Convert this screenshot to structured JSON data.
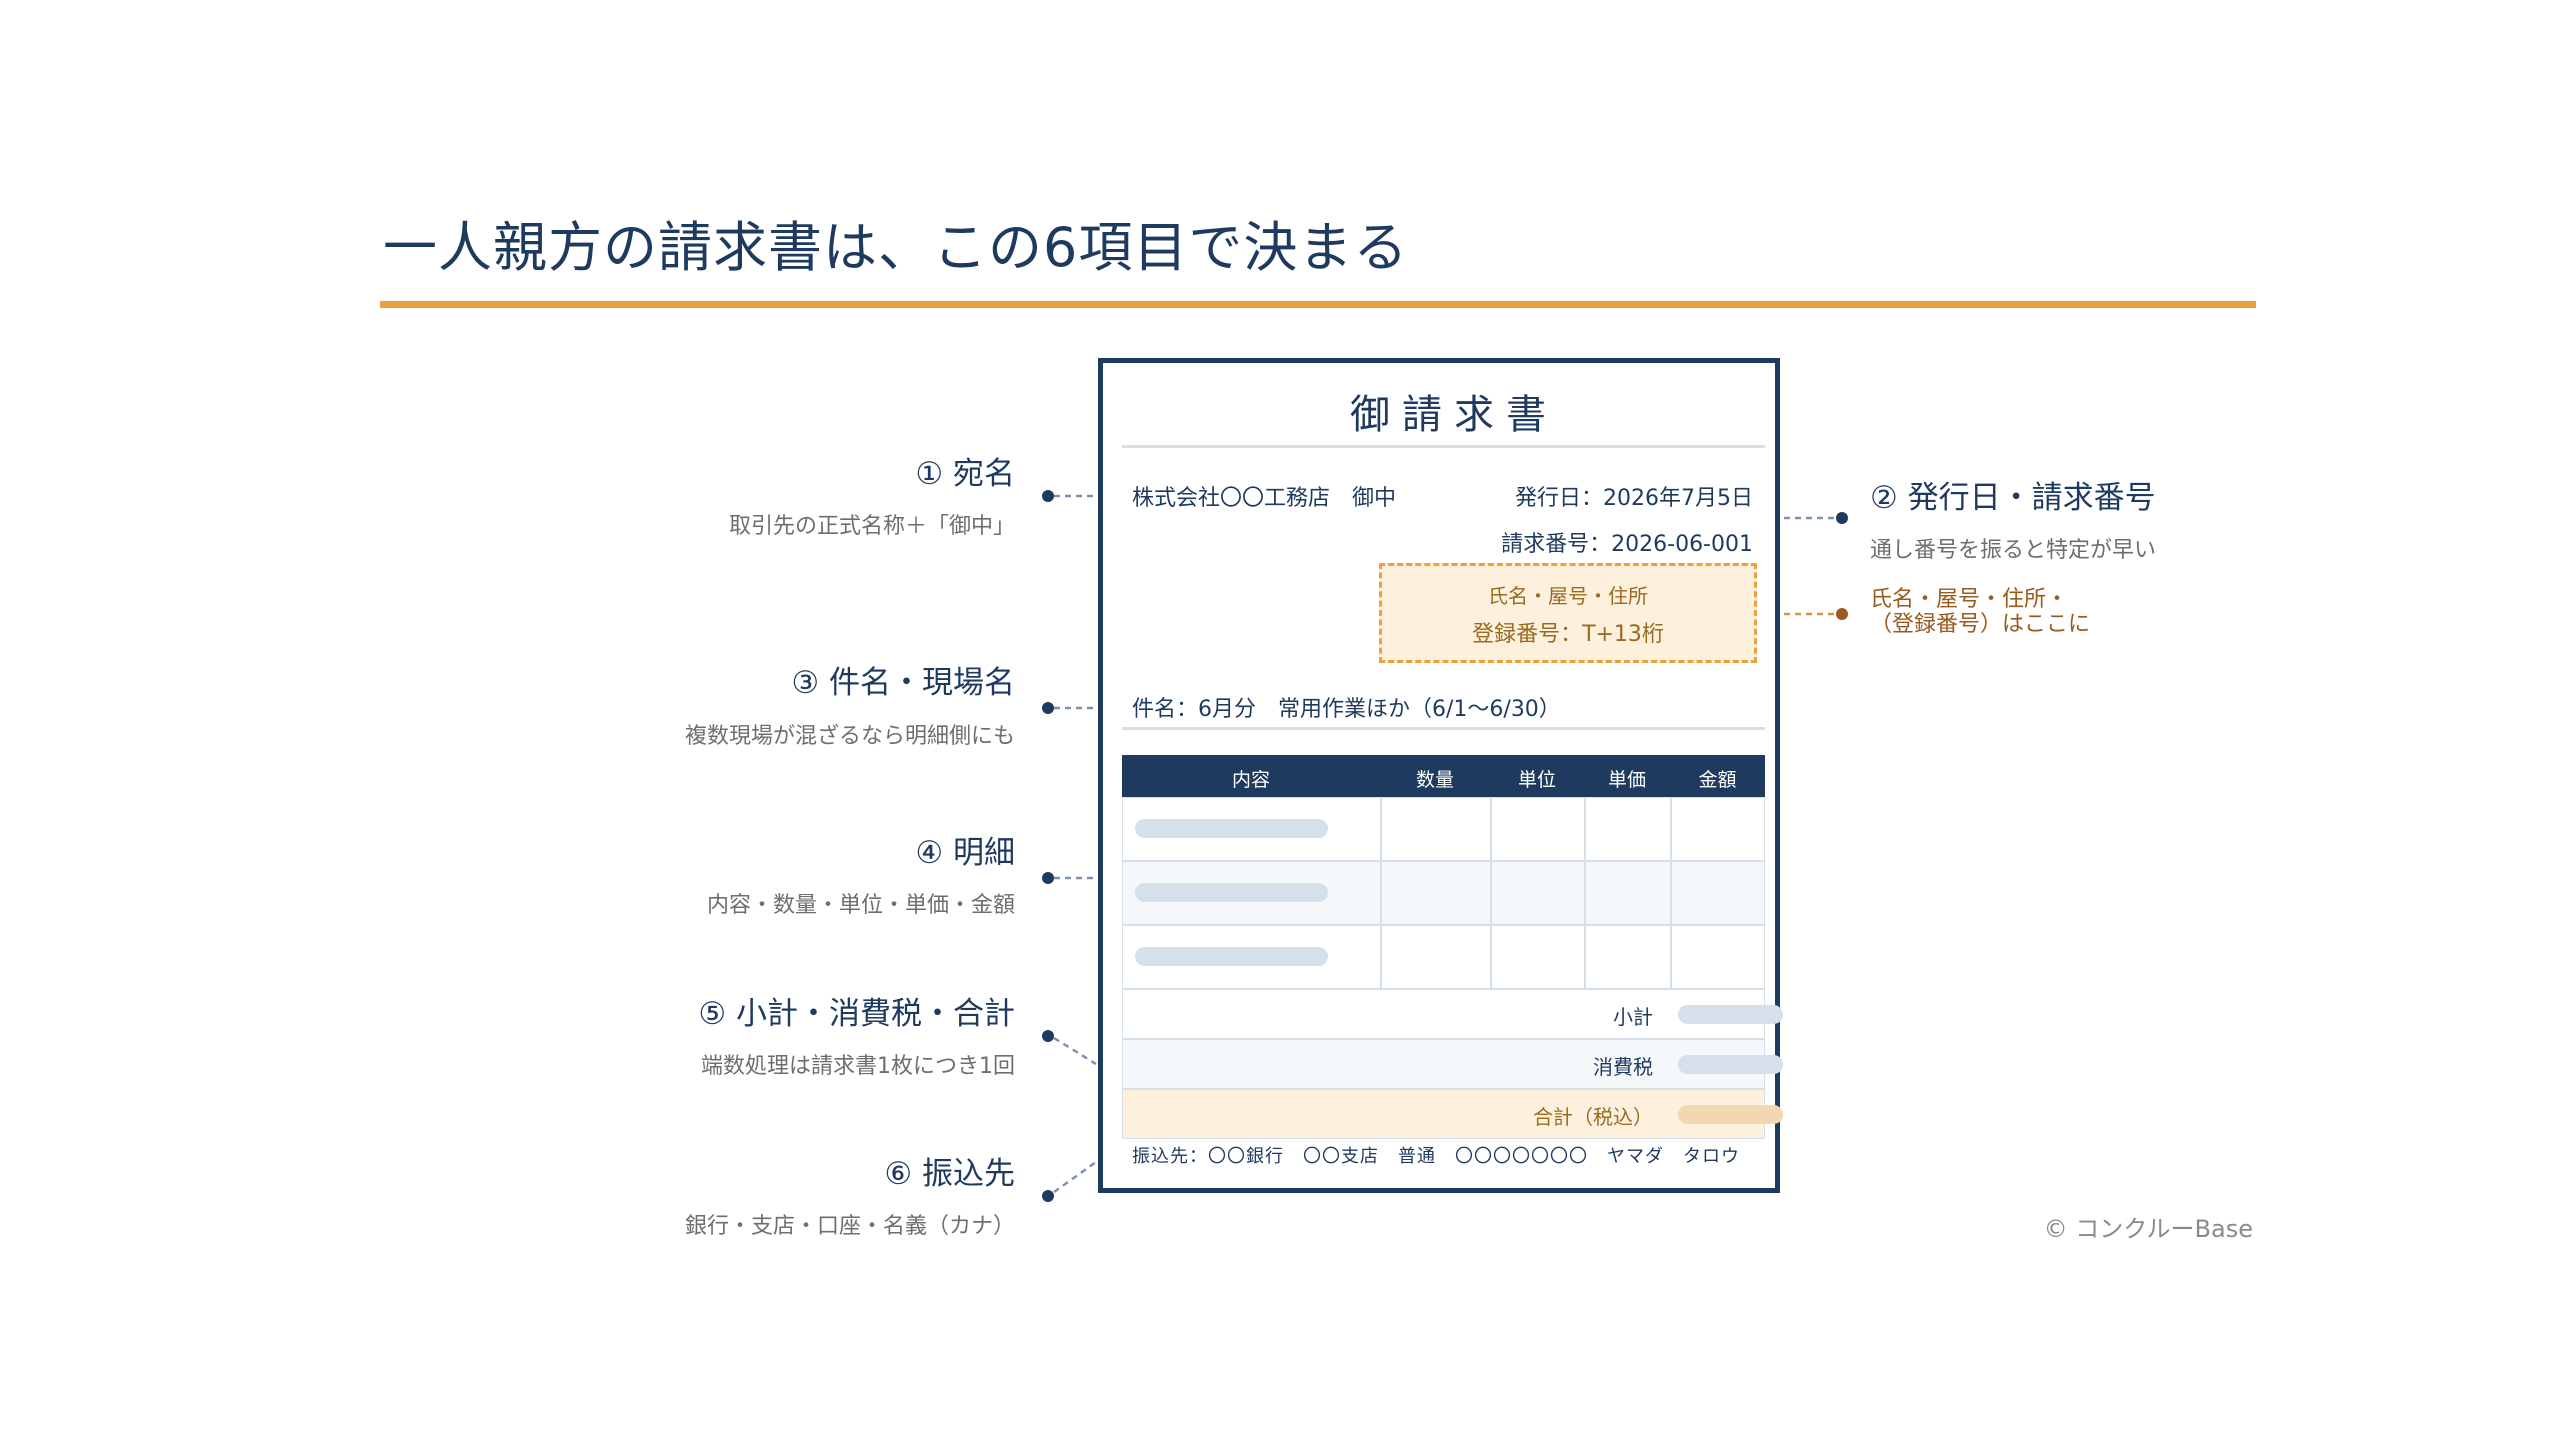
{
  "title": "一人親方の請求書は、この6項目で決まる",
  "copyright": "© コンクルーBase",
  "callouts": [
    {
      "title": "① 宛名",
      "sub": "取引先の正式名称＋「御中」"
    },
    {
      "title": "② 発行日・請求番号",
      "sub": "通し番号を振ると特定が早い"
    },
    {
      "title": "③ 件名・現場名",
      "sub": "複数現場が混ざるなら明細側にも"
    },
    {
      "title": "④ 明細",
      "sub": "内容・数量・単位・単価・金額"
    },
    {
      "title": "⑤ 小計・消費税・合計",
      "sub": "端数処理は請求書1枚につき1回"
    },
    {
      "title": "⑥ 振込先",
      "sub": "銀行・支店・口座・名義（カナ）"
    }
  ],
  "registration_note": {
    "line1": "氏名・屋号・住所・",
    "line2": "（登録番号）はここに"
  },
  "colors": {
    "navy": "#1f3a5f",
    "accent": "#eba23c",
    "note_brown": "#9a5a1f"
  },
  "invoice": {
    "heading": "御請求書",
    "recipient": "株式会社〇〇工務店　御中",
    "issue_date": "発行日：2026年7月5日",
    "invoice_number": "請求番号：2026-06-001",
    "reg_box": {
      "line1": "氏名・屋号・住所",
      "line2": "登録番号：T+13桁"
    },
    "subject": "件名：6月分　常用作業ほか（6/1〜6/30）",
    "columns": [
      "内容",
      "数量",
      "単位",
      "単価",
      "金額"
    ],
    "subtotal_label": "小計",
    "tax_label": "消費税",
    "total_label": "合計（税込）",
    "bank": "振込先：〇〇銀行　〇〇支店　普通　〇〇〇〇〇〇〇　ヤマダ　タロウ"
  }
}
